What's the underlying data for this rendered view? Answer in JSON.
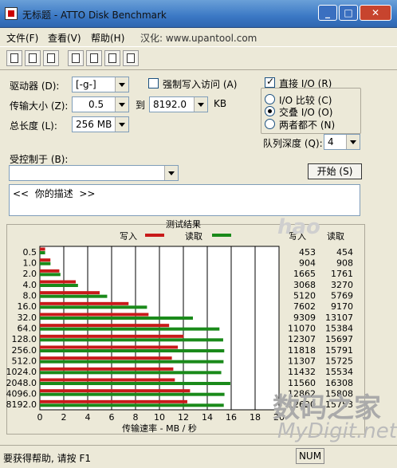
{
  "window": {
    "title": "无标题 - ATTO Disk Benchmark"
  },
  "menu": {
    "items": [
      "文件(F)",
      "查看(V)",
      "帮助(H)"
    ],
    "info": "汉化: www.upantool.com"
  },
  "toolbar": {
    "icons": [
      "new-icon",
      "open-icon",
      "save-icon",
      "print-icon",
      "print-preview-icon",
      "move-icon",
      "help-icon"
    ]
  },
  "settings": {
    "drive_label": "驱动器 (D):",
    "drive_value": "[-g-]",
    "write_cache_label": "强制写入访问 (A)",
    "transfer_label": "传输大小 (Z):",
    "transfer_from": "0.5",
    "to_label": "到",
    "transfer_to": "8192.0",
    "kb_label": "KB",
    "total_label": "总长度 (L):",
    "total_value": "256 MB",
    "direct_io_label": "直接 I/O (R)",
    "io_compare_label": "I/O 比较 (C)",
    "overlap_label": "交叠 I/O (O)",
    "neither_label": "两者都不 (N)",
    "queue_label": "队列深度 (Q):",
    "queue_value": "4",
    "controlled_label": "受控制于 (B):",
    "start_label": "开始 (S)",
    "description": "<<  你的描述  >>"
  },
  "chart_data": {
    "type": "bar",
    "title": "测试结果",
    "legend": [
      {
        "name": "写入",
        "color": "#c81a1a"
      },
      {
        "name": "读取",
        "color": "#1a8a1a"
      }
    ],
    "xlabel": "传输速率 - MB / 秒",
    "xlim": [
      0,
      20
    ],
    "xticks": [
      0,
      2,
      4,
      6,
      8,
      10,
      12,
      14,
      16,
      18,
      20
    ],
    "categories": [
      "0.5",
      "1.0",
      "2.0",
      "4.0",
      "8.0",
      "16.0",
      "32.0",
      "64.0",
      "128.0",
      "256.0",
      "512.0",
      "1024.0",
      "2048.0",
      "4096.0",
      "8192.0"
    ],
    "series": [
      {
        "name": "写入",
        "color": "#c81a1a",
        "values": [
          0.44,
          0.88,
          1.63,
          3.0,
          5.0,
          7.42,
          9.09,
          10.81,
          12.02,
          11.54,
          11.04,
          11.16,
          11.29,
          12.56,
          12.33
        ]
      },
      {
        "name": "读取",
        "color": "#1a8a1a",
        "values": [
          0.44,
          0.89,
          1.72,
          3.19,
          5.63,
          8.96,
          12.8,
          15.02,
          15.33,
          15.42,
          15.36,
          15.17,
          15.93,
          15.44,
          15.38
        ]
      }
    ],
    "table_header": [
      "写入",
      "读取"
    ],
    "table": [
      [
        "453",
        "454"
      ],
      [
        "904",
        "908"
      ],
      [
        "1665",
        "1761"
      ],
      [
        "3068",
        "3270"
      ],
      [
        "5120",
        "5769"
      ],
      [
        "7602",
        "9170"
      ],
      [
        "9309",
        "13107"
      ],
      [
        "11070",
        "15384"
      ],
      [
        "12307",
        "15697"
      ],
      [
        "11818",
        "15791"
      ],
      [
        "11307",
        "15725"
      ],
      [
        "11432",
        "15534"
      ],
      [
        "11560",
        "16308"
      ],
      [
        "12862",
        "15808"
      ],
      [
        "12620",
        "15753"
      ]
    ]
  },
  "status": {
    "text": "要获得帮助, 请按 F1",
    "num": "NUM"
  },
  "watermarks": {
    "hao": "hao",
    "site_cn": "数码之家",
    "site_en": "MyDigit.net"
  }
}
